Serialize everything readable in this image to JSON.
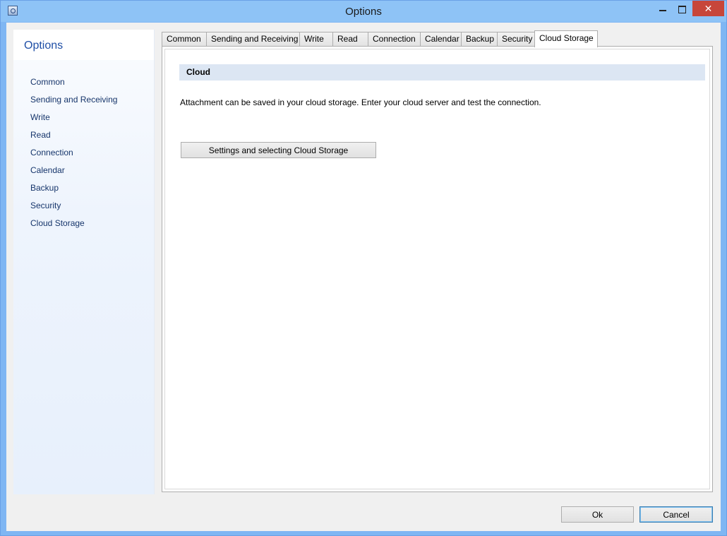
{
  "window": {
    "title": "Options",
    "close_symbol": "✕"
  },
  "sidebar": {
    "title": "Options",
    "items": [
      {
        "label": "Common"
      },
      {
        "label": "Sending and Receiving"
      },
      {
        "label": "Write"
      },
      {
        "label": "Read"
      },
      {
        "label": "Connection"
      },
      {
        "label": "Calendar"
      },
      {
        "label": "Backup"
      },
      {
        "label": "Security"
      },
      {
        "label": "Cloud Storage"
      }
    ]
  },
  "tabs": [
    {
      "label": "Common"
    },
    {
      "label": "Sending and Receiving"
    },
    {
      "label": "Write"
    },
    {
      "label": "Read"
    },
    {
      "label": "Connection"
    },
    {
      "label": "Calendar"
    },
    {
      "label": "Backup"
    },
    {
      "label": "Security"
    },
    {
      "label": "Cloud Storage",
      "active": true
    }
  ],
  "panel": {
    "section_title": "Cloud",
    "description": "Attachment can be saved in your cloud storage. Enter your cloud server and test the connection.",
    "settings_button_label": "Settings and selecting Cloud Storage"
  },
  "footer": {
    "ok_label": "Ok",
    "cancel_label": "Cancel"
  }
}
